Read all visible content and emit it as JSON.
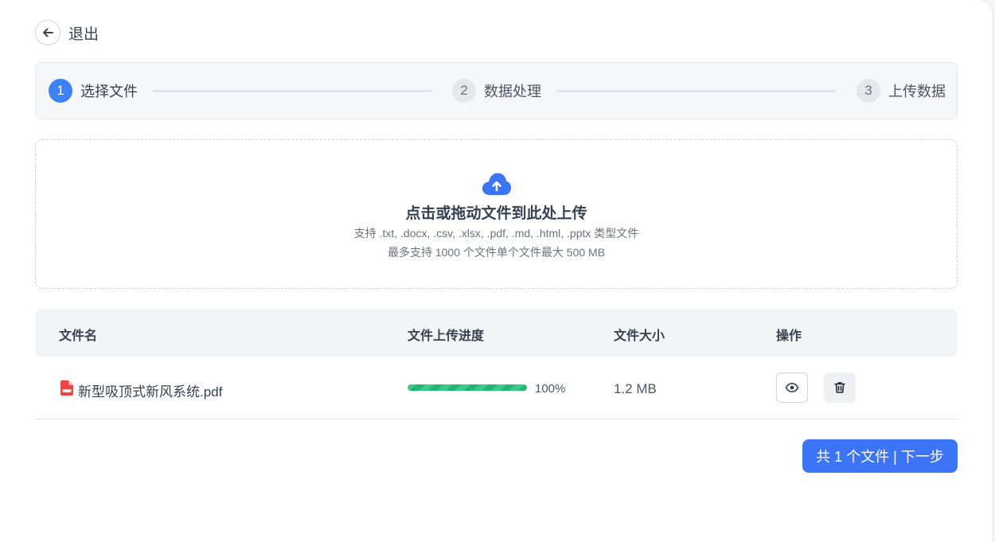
{
  "header": {
    "back_label": "退出"
  },
  "steps": [
    {
      "num": "1",
      "label": "选择文件",
      "active": true
    },
    {
      "num": "2",
      "label": "数据处理",
      "active": false
    },
    {
      "num": "3",
      "label": "上传数据",
      "active": false
    }
  ],
  "upload": {
    "title": "点击或拖动文件到此处上传",
    "hint_types": "支持 .txt, .docx, .csv, .xlsx, .pdf, .md, .html, .pptx 类型文件",
    "hint_limits": "最多支持 1000 个文件单个文件最大 500 MB"
  },
  "table": {
    "columns": [
      "文件名",
      "文件上传进度",
      "文件大小",
      "操作"
    ],
    "rows": [
      {
        "name": "新型吸顶式新风系统.pdf",
        "progress": 100,
        "progress_text": "100%",
        "size": "1.2 MB"
      }
    ]
  },
  "footer": {
    "next_label": "共 1 个文件 | 下一步"
  },
  "colors": {
    "accent": "#3b74f6",
    "progress": "#22b573",
    "pdf": "#ef4444"
  },
  "icons": {
    "back": "arrow-left-icon",
    "upload": "cloud-upload-icon",
    "file": "pdf-file-icon",
    "view": "eye-icon",
    "delete": "trash-icon"
  }
}
